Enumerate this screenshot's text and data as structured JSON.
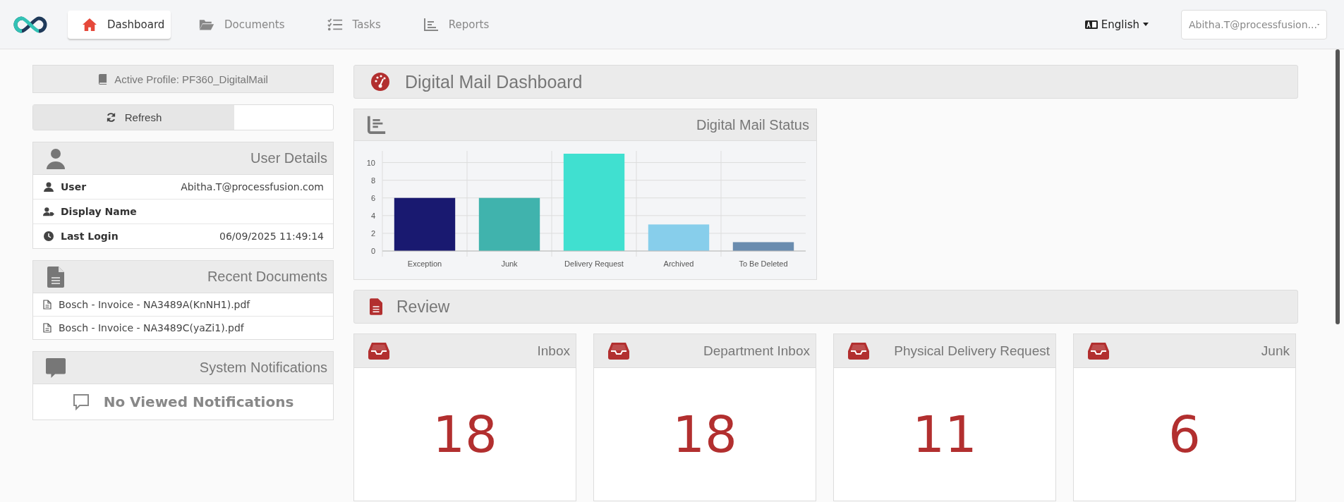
{
  "nav": {
    "tabs": [
      {
        "label": "Dashboard",
        "kind": "home",
        "selected": true
      },
      {
        "label": "Documents",
        "kind": "folder",
        "selected": false
      },
      {
        "label": "Tasks",
        "kind": "tasks",
        "selected": false
      },
      {
        "label": "Reports",
        "kind": "chart",
        "selected": false
      }
    ],
    "language": "English",
    "user_select": "Abitha.T@processfusion..."
  },
  "sidebar": {
    "active_profile": "Active Profile: PF360_DigitalMail",
    "refresh": "Refresh",
    "user_details": {
      "title": "User Details",
      "rows": [
        {
          "kind": "user",
          "label": "User",
          "value": "Abitha.T@processfusion.com"
        },
        {
          "kind": "user-tag",
          "label": "Display Name"
        },
        {
          "kind": "clock",
          "label": "Last Login",
          "value": "06/09/2025 11:49:14"
        }
      ]
    },
    "recent_documents": {
      "title": "Recent Documents",
      "items": [
        "Bosch - Invoice - NA3489A(KnNH1).pdf",
        "Bosch - Invoice - NA3489C(yaZi1).pdf"
      ]
    },
    "notifications": {
      "title": "System Notifications",
      "empty": "No Viewed Notifications"
    }
  },
  "main": {
    "title": "Digital Mail Dashboard",
    "status_panel": {
      "title": "Digital Mail Status",
      "chart_data": {
        "type": "bar",
        "categories": [
          "Exception",
          "Junk",
          "Delivery Request",
          "Archived",
          "To Be Deleted"
        ],
        "series": [
          {
            "values": [
              6,
              6,
              11,
              3,
              1
            ]
          }
        ],
        "colors": [
          "#191970",
          "#40b3ad",
          "#40e0d0",
          "#87ceeb",
          "#6a8caf"
        ],
        "ylim": [
          0,
          11
        ],
        "yticks": [
          0,
          2,
          4,
          6,
          8,
          10
        ],
        "grid": true
      }
    },
    "review": {
      "title": "Review",
      "cards": [
        {
          "title": "Inbox",
          "count": "18"
        },
        {
          "title": "Department Inbox",
          "count": "18"
        },
        {
          "title": "Physical Delivery Request",
          "count": "11"
        },
        {
          "title": "Junk",
          "count": "6"
        }
      ]
    }
  }
}
